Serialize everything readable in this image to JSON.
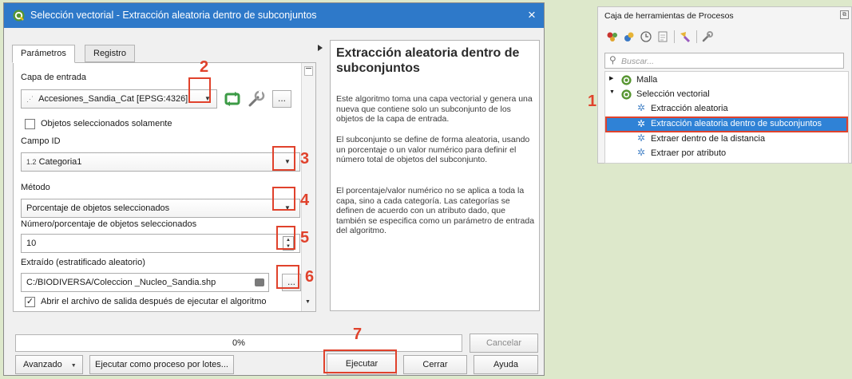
{
  "dialog": {
    "title": "Selección vectorial - Extracción aleatoria dentro de subconjuntos",
    "close_glyph": "×",
    "tabs": [
      "Parámetros",
      "Registro"
    ],
    "params": {
      "input_layer_label": "Capa de entrada",
      "input_layer_value": "Accesiones_Sandia_Cat [EPSG:4326]",
      "selected_only_label": "Objetos seleccionados solamente",
      "field_id_label": "Campo ID",
      "field_type_prefix": "1.2",
      "field_id_value": "Categoria1",
      "method_label": "Método",
      "method_value": "Porcentaje de objetos seleccionados",
      "number_label": "Número/porcentaje de objetos seleccionados",
      "number_value": "10",
      "output_label": "Extraído (estratificado aleatorio)",
      "output_value": "C:/BIODIVERSA/Coleccion _Nucleo_Sandia.shp",
      "open_output_label": "Abrir el archivo de salida después de ejecutar el algoritmo",
      "open_output_checked": true,
      "browse_glyph": "..."
    },
    "help": {
      "title": "Extracción aleatoria dentro de subconjuntos",
      "para1": "Este algoritmo toma una capa vectorial y genera una nueva que contiene solo un subconjunto de los objetos de la capa de entrada.",
      "para2": "El subconjunto se define de forma aleatoria, usando un porcentaje o un valor numérico para definir el número total de objetos del subconjunto.",
      "para3": "El porcentaje/valor numérico no se aplica a toda la capa, sino a cada categoría. Las categorías se definen de acuerdo con un atributo dado, que también se especifica como un parámetro de entrada del algoritmo."
    },
    "progress": {
      "text": "0%",
      "value_percent": 0
    },
    "buttons": {
      "cancel": "Cancelar",
      "advanced": "Avanzado",
      "batch": "Ejecutar como proceso por lotes...",
      "run": "Ejecutar",
      "close": "Cerrar",
      "help": "Ayuda"
    },
    "markers": [
      "1",
      "2",
      "3",
      "4",
      "5",
      "6",
      "7"
    ]
  },
  "toolbox": {
    "title": "Caja de herramientas de Procesos",
    "search_placeholder": "Buscar...",
    "tree": [
      {
        "label": "Malla",
        "expanded": false,
        "icon": "qgis-icon"
      },
      {
        "label": "Selección vectorial",
        "expanded": true,
        "icon": "qgis-icon"
      },
      {
        "label": "Extracción aleatoria",
        "icon": "gear-icon"
      },
      {
        "label": "Extracción aleatoria dentro de subconjuntos",
        "icon": "gear-icon",
        "selected": true
      },
      {
        "label": "Extraer dentro de la distancia",
        "icon": "gear-icon"
      },
      {
        "label": "Extraer por atributo",
        "icon": "gear-icon"
      }
    ]
  },
  "colors": {
    "titlebar": "#2e79c9",
    "annotation_red": "#e0422c",
    "selection": "#2f82d6",
    "background": "#dde8cb",
    "qgis_green": "#589632"
  }
}
